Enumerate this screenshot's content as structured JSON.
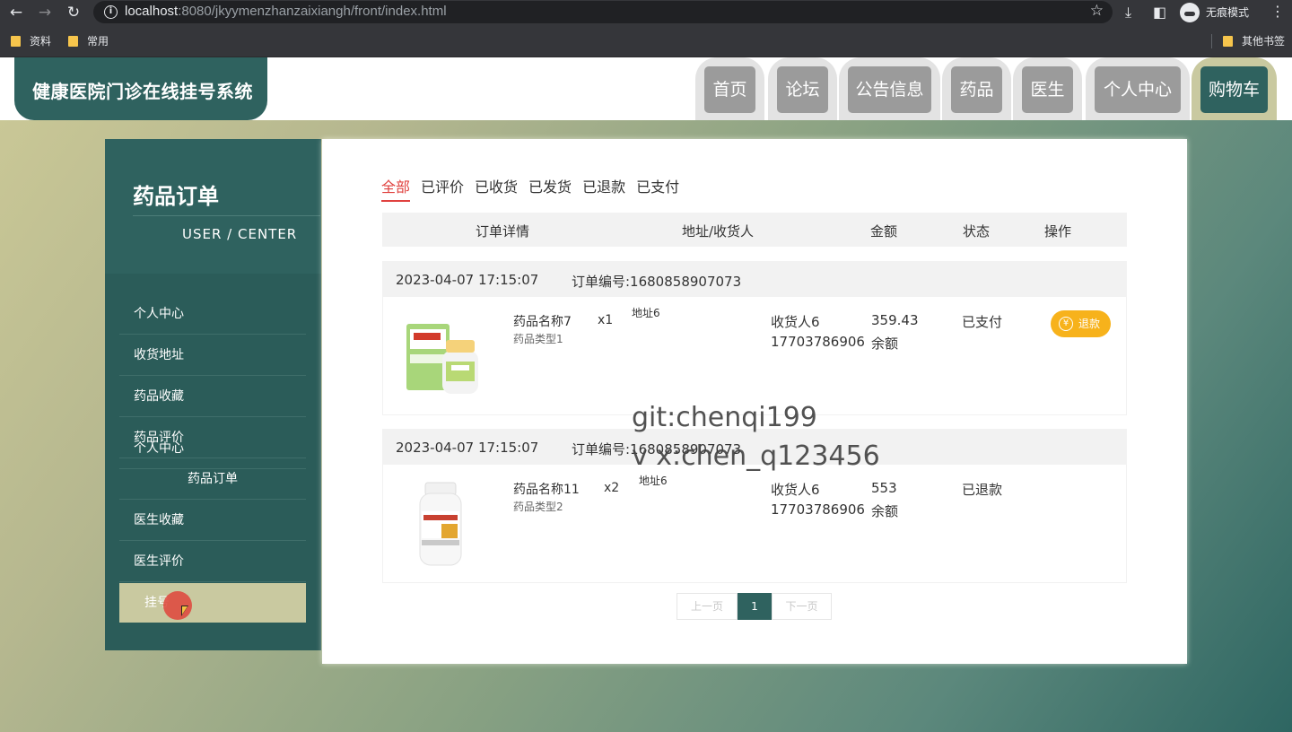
{
  "browser": {
    "url_host": "localhost",
    "url_rest": ":8080/jkyymenzhanzaixiangh/front/index.html",
    "incognito_label": "无痕模式",
    "bookmarks": [
      "资料",
      "常用"
    ],
    "other_bookmarks": "其他书签"
  },
  "header": {
    "site_title": "健康医院门诊在线挂号系统",
    "nav": [
      "首页",
      "论坛",
      "公告信息",
      "药品",
      "医生",
      "个人中心",
      "购物车"
    ]
  },
  "sidebar": {
    "title": "药品订单",
    "subtitle": "USER / CENTER",
    "items": [
      "个人中心",
      "收货地址",
      "药品收藏",
      "药品评价",
      "药品订单",
      "医生收藏",
      "医生评价",
      "挂号"
    ]
  },
  "tabs": [
    "全部",
    "已评价",
    "已收货",
    "已发货",
    "已退款",
    "已支付"
  ],
  "table_headers": [
    "订单详情",
    "地址/收货人",
    "金额",
    "状态",
    "操作"
  ],
  "orders": [
    {
      "time": "2023-04-07 17:15:07",
      "order_no": "订单编号:1680858907073",
      "name": "药品名称7",
      "type": "药品类型1",
      "qty": "x1",
      "address": "地址6",
      "receiver": "收货人6",
      "phone": "17703786906",
      "amount": "359.43",
      "pay": "余额",
      "status": "已支付",
      "action": "退款"
    },
    {
      "time": "2023-04-07 17:15:07",
      "order_no": "订单编号:1680858907073",
      "name": "药品名称11",
      "type": "药品类型2",
      "qty": "x2",
      "address": "地址6",
      "receiver": "收货人6",
      "phone": "17703786906",
      "amount": "553",
      "pay": "余额",
      "status": "已退款"
    }
  ],
  "pager": {
    "prev": "上一页",
    "current": "1",
    "next": "下一页"
  },
  "watermark": [
    "git:chenqi199",
    "v x:chen_q123456"
  ],
  "colors": {
    "primary": "#2f625f",
    "accent": "#e0423f",
    "refund": "#f7b21b",
    "highlight": "#c9c9a0"
  }
}
